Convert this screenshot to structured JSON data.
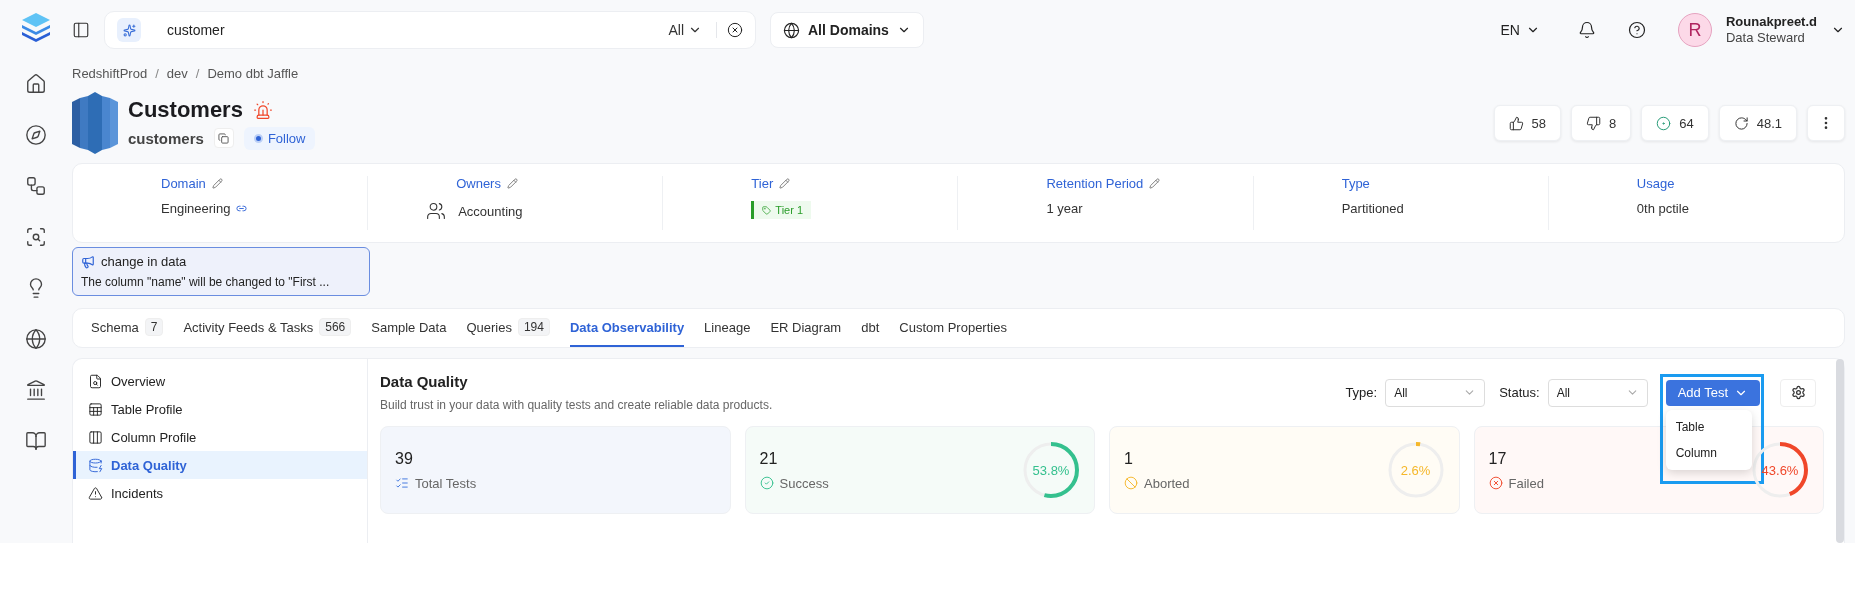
{
  "search": {
    "value": "customer",
    "scope": "All"
  },
  "domain_selector": "All Domains",
  "language": "EN",
  "user": {
    "initial": "R",
    "name": "Rounakpreet.d",
    "role": "Data Steward"
  },
  "breadcrumbs": [
    "RedshiftProd",
    "dev",
    "Demo dbt Jaffle"
  ],
  "breadcrumb_separator": "/",
  "entity": {
    "title": "Customers",
    "name": "customers",
    "follow": "Follow"
  },
  "stats": [
    {
      "kind": "upvote",
      "value": "58"
    },
    {
      "kind": "downvote",
      "value": "8"
    },
    {
      "kind": "checks",
      "value": "64"
    },
    {
      "kind": "version",
      "value": "48.1"
    }
  ],
  "properties": [
    {
      "kind": "domain",
      "label": "Domain",
      "value": "Engineering",
      "editable": true
    },
    {
      "kind": "owner",
      "label": "Owners",
      "value": "Accounting",
      "editable": true
    },
    {
      "kind": "tier",
      "label": "Tier",
      "value": "Tier 1",
      "editable": true
    },
    {
      "kind": "text",
      "label": "Retention Period",
      "value": "1 year",
      "editable": true
    },
    {
      "kind": "text",
      "label": "Type",
      "value": "Partitioned",
      "editable": false
    },
    {
      "kind": "text",
      "label": "Usage",
      "value": "0th pctile",
      "editable": false
    }
  ],
  "announcement": {
    "title": "change in data",
    "text": "The column \"name\" will be changed to \"First ..."
  },
  "tabs": [
    {
      "label": "Schema",
      "count": "7",
      "selected": false
    },
    {
      "label": "Activity Feeds & Tasks",
      "count": "566",
      "selected": false
    },
    {
      "label": "Sample Data",
      "selected": false
    },
    {
      "label": "Queries",
      "count": "194",
      "selected": false
    },
    {
      "label": "Data Observability",
      "selected": true
    },
    {
      "label": "Lineage",
      "selected": false
    },
    {
      "label": "ER Diagram",
      "selected": false
    },
    {
      "label": "dbt",
      "selected": false
    },
    {
      "label": "Custom Properties",
      "selected": false
    }
  ],
  "side_menu": [
    {
      "kind": "overview",
      "label": "Overview",
      "selected": false
    },
    {
      "kind": "table",
      "label": "Table Profile",
      "selected": false
    },
    {
      "kind": "column",
      "label": "Column Profile",
      "selected": false
    },
    {
      "kind": "quality",
      "label": "Data Quality",
      "selected": true
    },
    {
      "kind": "incidents",
      "label": "Incidents",
      "selected": false
    }
  ],
  "data_quality": {
    "title": "Data Quality",
    "subtitle": "Build trust in your data with quality tests and create reliable data products.",
    "filters": [
      {
        "label": "Type:",
        "value": "All"
      },
      {
        "label": "Status:",
        "value": "All"
      }
    ],
    "add_test": {
      "label": "Add Test",
      "expanded": true,
      "items": [
        "Table",
        "Column"
      ]
    },
    "cards": [
      {
        "kind": "total",
        "value": "39",
        "label": "Total Tests"
      },
      {
        "kind": "success",
        "value": "21",
        "label": "Success",
        "percent": "53.8%",
        "level": 0.538
      },
      {
        "kind": "aborted",
        "value": "1",
        "label": "Aborted",
        "percent": "2.6%",
        "level": 0.026
      },
      {
        "kind": "failed",
        "value": "17",
        "label": "Failed",
        "percent": "43.6%",
        "level": 0.436
      }
    ]
  }
}
